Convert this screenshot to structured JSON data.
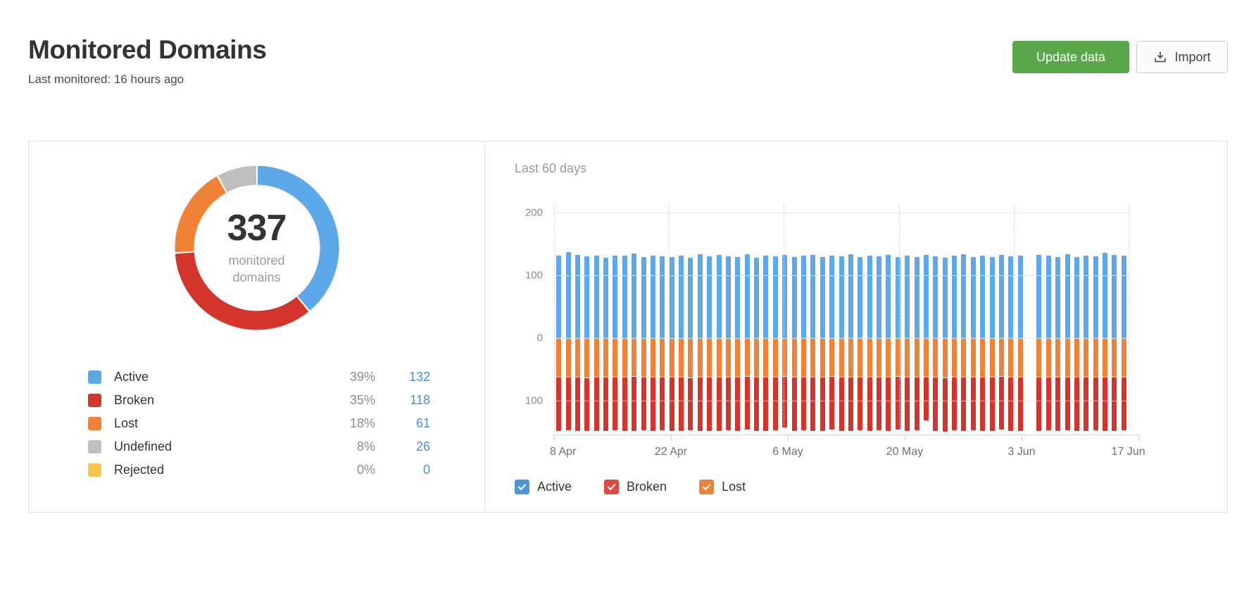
{
  "header": {
    "title": "Monitored Domains",
    "subtitle": "Last monitored: 16 hours ago",
    "update_button": "Update data",
    "import_button": "Import",
    "accent_green": "#5aa74a"
  },
  "donut": {
    "total": "337",
    "sub_line1": "monitored",
    "sub_line2": "domains",
    "segments": [
      {
        "label": "Active",
        "percent": 39,
        "color": "#5da8e8"
      },
      {
        "label": "Broken",
        "percent": 35,
        "color": "#d3352c"
      },
      {
        "label": "Lost",
        "percent": 18,
        "color": "#ef8236"
      },
      {
        "label": "Undefined",
        "percent": 8,
        "color": "#bfbfbf"
      },
      {
        "label": "Rejected",
        "percent": 0,
        "color": "#f4c64b"
      }
    ]
  },
  "legend": {
    "rows": [
      {
        "label": "Active",
        "percent": "39%",
        "count": "132",
        "color": "#5da8e8"
      },
      {
        "label": "Broken",
        "percent": "35%",
        "count": "118",
        "color": "#d3352c"
      },
      {
        "label": "Lost",
        "percent": "18%",
        "count": "61",
        "color": "#ef8236"
      },
      {
        "label": "Undefined",
        "percent": "8%",
        "count": "26",
        "color": "#bfbfbf"
      },
      {
        "label": "Rejected",
        "percent": "0%",
        "count": "0",
        "color": "#f4c64b"
      }
    ]
  },
  "chart": {
    "title": "Last 60 days",
    "series_legend": [
      {
        "label": "Active",
        "color": "#4a97de",
        "checked": true
      },
      {
        "label": "Broken",
        "color": "#e24a3f",
        "checked": true
      },
      {
        "label": "Lost",
        "color": "#ef8236",
        "checked": true
      }
    ]
  },
  "chart_data": {
    "type": "bar",
    "title": "Last 60 days",
    "subtype": "diverging-stacked",
    "xlabel": "",
    "ylabel": "",
    "grid": true,
    "legend_position": "bottom",
    "x_tick_labels": [
      "8 Apr",
      "22 Apr",
      "6 May",
      "20 May",
      "3 Jun",
      "17 Jun"
    ],
    "x_tick_positions": [
      0,
      0.2,
      0.4,
      0.6,
      0.8,
      1.0
    ],
    "y_tick_labels": [
      "200",
      "100",
      "0",
      "100"
    ],
    "y_tick_values": [
      200,
      100,
      0,
      -100
    ],
    "ylim": [
      -145,
      215
    ],
    "series": [
      {
        "name": "Active",
        "color": "#5da8e8",
        "direction": "up",
        "values": [
          132,
          137,
          133,
          131,
          132,
          128,
          132,
          132,
          135,
          129,
          132,
          131,
          130,
          132,
          128,
          134,
          131,
          133,
          131,
          130,
          134,
          128,
          132,
          131,
          133,
          130,
          132,
          133,
          129,
          132,
          131,
          134,
          130,
          132,
          131,
          133,
          129,
          132,
          130,
          133,
          131,
          128,
          132,
          134,
          130,
          132,
          129,
          133,
          131,
          132,
          null,
          133,
          132,
          130,
          134,
          129,
          132,
          131,
          136,
          133,
          132
        ]
      },
      {
        "name": "Lost",
        "color": "#ef8236",
        "direction": "down",
        "values": [
          61,
          61,
          61,
          62,
          61,
          61,
          61,
          61,
          60,
          61,
          61,
          61,
          61,
          61,
          62,
          61,
          61,
          61,
          61,
          61,
          60,
          61,
          61,
          61,
          59,
          61,
          61,
          61,
          61,
          60,
          61,
          61,
          61,
          61,
          61,
          61,
          60,
          61,
          61,
          61,
          61,
          62,
          61,
          61,
          61,
          61,
          61,
          60,
          61,
          61,
          null,
          61,
          61,
          61,
          61,
          61,
          61,
          61,
          61,
          61,
          61
        ]
      },
      {
        "name": "Broken",
        "color": "#d3352c",
        "direction": "down",
        "stacked_after": "Lost",
        "values": [
          118,
          117,
          119,
          117,
          118,
          118,
          116,
          118,
          119,
          117,
          118,
          117,
          119,
          118,
          116,
          118,
          118,
          119,
          117,
          118,
          116,
          118,
          119,
          117,
          113,
          118,
          117,
          119,
          118,
          116,
          118,
          119,
          117,
          118,
          117,
          119,
          116,
          118,
          117,
          95,
          118,
          119,
          117,
          118,
          116,
          118,
          119,
          117,
          118,
          118,
          null,
          119,
          117,
          118,
          116,
          118,
          119,
          117,
          118,
          118,
          117
        ]
      }
    ]
  }
}
